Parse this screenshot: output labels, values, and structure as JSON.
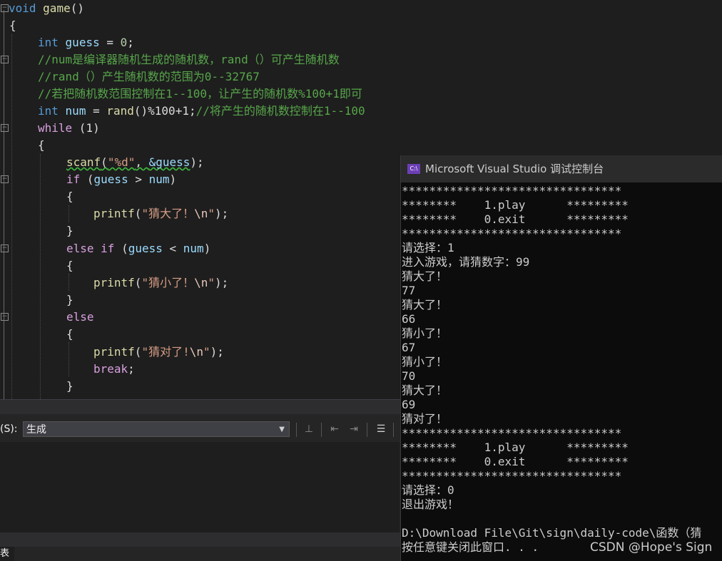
{
  "editor": {
    "lines": {
      "l0": [
        "void",
        " ",
        "game",
        "()"
      ],
      "l1": [
        "{"
      ],
      "l2": [
        "int",
        " ",
        "guess",
        " = ",
        "0",
        ";"
      ],
      "l3": [
        "//num是编译器随机生成的随机数，rand（）可产生随机数"
      ],
      "l4": [
        "//rand（）产生随机数的范围为0--32767"
      ],
      "l5": [
        "//若把随机数范围控制在1--100，让产生的随机数%100+1即可"
      ],
      "l6": [
        "int",
        " ",
        "num",
        " = ",
        "rand",
        "()%100+1;",
        "//将产生的随机数控制在1--100"
      ],
      "l7": [
        "while",
        " (1)"
      ],
      "l8": [
        "{"
      ],
      "l9": [
        "scanf",
        "(",
        "\"%d\"",
        ", ",
        "&guess",
        ");"
      ],
      "l10": [
        "if",
        " (",
        "guess",
        " > ",
        "num",
        ")"
      ],
      "l11": [
        "{"
      ],
      "l12": [
        "printf",
        "(",
        "\"猜大了！",
        "\\n",
        "\"",
        ");"
      ],
      "l13": [
        "}"
      ],
      "l14": [
        "else",
        " ",
        "if",
        " (",
        "guess",
        " < ",
        "num",
        ")"
      ],
      "l15": [
        "{"
      ],
      "l16": [
        "printf",
        "(",
        "\"猜小了！",
        "\\n",
        "\"",
        ");"
      ],
      "l17": [
        "}"
      ],
      "l18": [
        "else"
      ],
      "l19": [
        "{"
      ],
      "l20": [
        "printf",
        "(",
        "\"猜对了!",
        "\\n",
        "\"",
        ");"
      ],
      "l21": [
        "break",
        ";"
      ],
      "l22": [
        "}"
      ]
    }
  },
  "output_panel": {
    "source_label": "(S):",
    "source_value": "生成",
    "bottom_tab_label": "表"
  },
  "console": {
    "title": "Microsoft Visual Studio 调试控制台",
    "icon_text": "C:\\",
    "lines": [
      "********************************",
      "********    1.play      *********",
      "********    0.exit      *********",
      "********************************",
      "请选择：1",
      "进入游戏，请猜数字：99",
      "猜大了！",
      "77",
      "猜大了！",
      "66",
      "猜小了！",
      "67",
      "猜小了！",
      "70",
      "猜大了！",
      "69",
      "猜对了！",
      "********************************",
      "********    1.play      *********",
      "********    0.exit      *********",
      "********************************",
      "请选择：0",
      "退出游戏！",
      "",
      "D:\\Download File\\Git\\sign\\daily-code\\函数（猜",
      "按任意键关闭此窗口. . ."
    ],
    "watermark": "CSDN @Hope's Sign"
  }
}
